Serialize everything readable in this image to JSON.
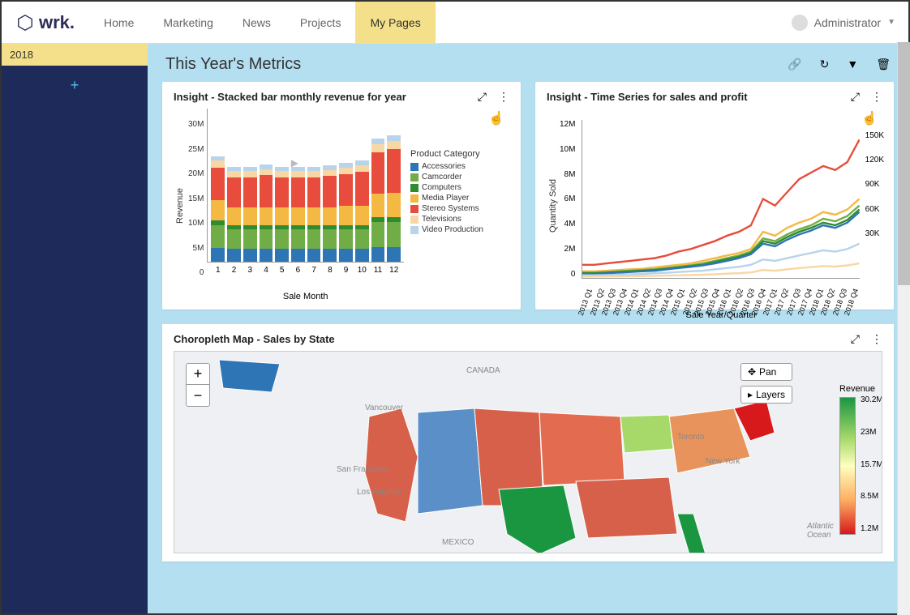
{
  "brand": "wrk.",
  "nav": [
    "Home",
    "Marketing",
    "News",
    "Projects",
    "My Pages"
  ],
  "nav_active_index": 4,
  "user": {
    "label": "Administrator"
  },
  "sidebar": {
    "year": "2018"
  },
  "page": {
    "title": "This Year's Metrics"
  },
  "cards": {
    "stacked": {
      "title": "Insight - Stacked bar monthly revenue for year",
      "xlabel": "Sale Month",
      "ylabel": "Revenue",
      "legend_title": "Product Category"
    },
    "timeseries": {
      "title": "Insight - Time Series for sales and profit",
      "ylabel": "Quantity Sold",
      "xlabel": "Sale Year/Quarter"
    },
    "map": {
      "title": "Choropleth Map - Sales by State",
      "pan": "Pan",
      "layers": "Layers",
      "legend_title": "Revenue"
    }
  },
  "chart_data": [
    {
      "type": "bar",
      "stacked": true,
      "title": "Insight - Stacked bar monthly revenue for year",
      "xlabel": "Sale Month",
      "ylabel": "Revenue",
      "categories": [
        "1",
        "2",
        "3",
        "4",
        "5",
        "6",
        "7",
        "8",
        "9",
        "10",
        "11",
        "12"
      ],
      "ylim": [
        0,
        30000000
      ],
      "y_ticks": [
        "30M",
        "25M",
        "20M",
        "15M",
        "10M",
        "5M",
        "0"
      ],
      "series": [
        {
          "name": "Accessories",
          "color": "#2e75b6",
          "values": [
            3000000,
            2800000,
            2800000,
            2800000,
            2800000,
            2800000,
            2800000,
            2800000,
            2800000,
            2800000,
            3200000,
            3200000
          ]
        },
        {
          "name": "Camcorder",
          "color": "#70ad47",
          "values": [
            5000000,
            4200000,
            4200000,
            4200000,
            4200000,
            4200000,
            4200000,
            4200000,
            4200000,
            4200000,
            5500000,
            5500000
          ]
        },
        {
          "name": "Computers",
          "color": "#2e8b2e",
          "values": [
            1000000,
            900000,
            900000,
            900000,
            900000,
            900000,
            900000,
            900000,
            900000,
            900000,
            1100000,
            1100000
          ]
        },
        {
          "name": "Media Player",
          "color": "#f4b942",
          "values": [
            4500000,
            4000000,
            4000000,
            4000000,
            4000000,
            4000000,
            4000000,
            4000000,
            4200000,
            4200000,
            5000000,
            5200000
          ]
        },
        {
          "name": "Stereo Systems",
          "color": "#e74c3c",
          "values": [
            7000000,
            6500000,
            6500000,
            7000000,
            6500000,
            6500000,
            6500000,
            6800000,
            7000000,
            7500000,
            9000000,
            9500000
          ]
        },
        {
          "name": "Televisions",
          "color": "#f8d7a4",
          "values": [
            1500000,
            1300000,
            1300000,
            1300000,
            1300000,
            1300000,
            1300000,
            1300000,
            1400000,
            1400000,
            1800000,
            1800000
          ]
        },
        {
          "name": "Video Production",
          "color": "#b8d4ea",
          "values": [
            1000000,
            1000000,
            1000000,
            1000000,
            1000000,
            1000000,
            1000000,
            1000000,
            1000000,
            1000000,
            1200000,
            1200000
          ]
        }
      ]
    },
    {
      "type": "line",
      "title": "Insight - Time Series for sales and profit",
      "ylabel": "Quantity Sold",
      "y2label": "",
      "xlabel": "Sale Year/Quarter",
      "x": [
        "2013 Q1",
        "2013 Q2",
        "2013 Q3",
        "2013 Q4",
        "2014 Q1",
        "2014 Q2",
        "2014 Q3",
        "2014 Q4",
        "2015 Q1",
        "2015 Q2",
        "2015 Q3",
        "2015 Q4",
        "2016 Q1",
        "2016 Q2",
        "2016 Q3",
        "2016 Q4",
        "2017 Q1",
        "2017 Q2",
        "2017 Q3",
        "2017 Q4",
        "2018 Q1",
        "2018 Q2",
        "2018 Q3",
        "2018 Q4"
      ],
      "ylim": [
        0,
        12000000
      ],
      "y_ticks": [
        "12M",
        "10M",
        "8M",
        "6M",
        "4M",
        "2M",
        "0"
      ],
      "y2lim": [
        0,
        150000
      ],
      "y2_ticks": [
        "150K",
        "120K",
        "90K",
        "60K",
        "30K",
        ""
      ],
      "series": [
        {
          "name": "red",
          "color": "#e74c3c",
          "values": [
            1000000,
            1000000,
            1100000,
            1200000,
            1300000,
            1400000,
            1500000,
            1700000,
            2000000,
            2200000,
            2500000,
            2800000,
            3200000,
            3500000,
            4000000,
            6000000,
            5500000,
            6500000,
            7500000,
            8000000,
            8500000,
            8200000,
            8800000,
            10500000
          ]
        },
        {
          "name": "yellow",
          "color": "#f4b942",
          "values": [
            500000,
            500000,
            550000,
            600000,
            650000,
            700000,
            800000,
            900000,
            1000000,
            1100000,
            1300000,
            1500000,
            1700000,
            1900000,
            2200000,
            3500000,
            3200000,
            3800000,
            4200000,
            4500000,
            5000000,
            4800000,
            5200000,
            6000000
          ]
        },
        {
          "name": "green",
          "color": "#70ad47",
          "values": [
            400000,
            400000,
            450000,
            500000,
            550000,
            600000,
            650000,
            750000,
            850000,
            950000,
            1100000,
            1300000,
            1500000,
            1700000,
            2000000,
            3000000,
            2800000,
            3300000,
            3700000,
            4000000,
            4500000,
            4300000,
            4700000,
            5500000
          ]
        },
        {
          "name": "darkgreen",
          "color": "#2e8b2e",
          "values": [
            350000,
            350000,
            400000,
            450000,
            500000,
            550000,
            600000,
            700000,
            800000,
            900000,
            1000000,
            1200000,
            1400000,
            1600000,
            1900000,
            2800000,
            2600000,
            3100000,
            3500000,
            3800000,
            4200000,
            4000000,
            4400000,
            5200000
          ]
        },
        {
          "name": "blue",
          "color": "#2e75b6",
          "values": [
            300000,
            300000,
            350000,
            400000,
            450000,
            500000,
            550000,
            650000,
            750000,
            850000,
            950000,
            1100000,
            1300000,
            1500000,
            1800000,
            2600000,
            2400000,
            2900000,
            3300000,
            3600000,
            4000000,
            3800000,
            4200000,
            5000000
          ]
        },
        {
          "name": "lightblue",
          "color": "#b8d4ea",
          "values": [
            200000,
            200000,
            220000,
            250000,
            280000,
            300000,
            350000,
            400000,
            450000,
            500000,
            550000,
            650000,
            750000,
            850000,
            1000000,
            1400000,
            1300000,
            1500000,
            1700000,
            1900000,
            2100000,
            2000000,
            2200000,
            2600000
          ]
        },
        {
          "name": "tan",
          "color": "#f8d7a4",
          "values": [
            100000,
            100000,
            110000,
            120000,
            130000,
            140000,
            150000,
            180000,
            200000,
            220000,
            250000,
            280000,
            320000,
            360000,
            420000,
            600000,
            550000,
            650000,
            750000,
            820000,
            900000,
            860000,
            950000,
            1100000
          ]
        }
      ]
    },
    {
      "type": "heatmap",
      "title": "Choropleth Map - Sales by State",
      "legend_label": "Revenue",
      "scale_ticks": [
        "30.2M",
        "23M",
        "15.7M",
        "8.5M",
        "1.2M"
      ],
      "map_labels": [
        "CANADA",
        "Vancouver",
        "San Francisco",
        "Los Angeles",
        "Toronto",
        "New York",
        "MEXICO",
        "Atlantic Ocean"
      ]
    }
  ]
}
